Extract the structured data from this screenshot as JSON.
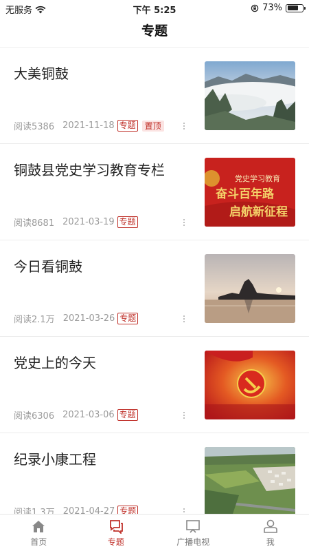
{
  "status_bar": {
    "carrier": "无服务",
    "time": "下午 5:25",
    "battery": "73%"
  },
  "nav": {
    "title": "专题"
  },
  "articles": [
    {
      "title": "大美铜鼓",
      "reads": "阅读5386",
      "date": "2021-11-18",
      "tag": "专题",
      "pin": "置顶"
    },
    {
      "title": "铜鼓县党史学习教育专栏",
      "reads": "阅读8681",
      "date": "2021-03-19",
      "tag": "专题",
      "thumb_text_small": "党史学习教育",
      "thumb_text_line1": "奋斗百年路",
      "thumb_text_line2": "启航新征程"
    },
    {
      "title": "今日看铜鼓",
      "reads": "阅读2.1万",
      "date": "2021-03-26",
      "tag": "专题"
    },
    {
      "title": "党史上的今天",
      "reads": "阅读6306",
      "date": "2021-03-06",
      "tag": "专题"
    },
    {
      "title": "纪录小康工程",
      "reads": "阅读1.3万",
      "date": "2021-04-27",
      "tag": "专题"
    }
  ],
  "tabbar": [
    {
      "label": "首页",
      "icon": "home-icon"
    },
    {
      "label": "专题",
      "icon": "chat-icon",
      "active": true
    },
    {
      "label": "广播电视",
      "icon": "tv-icon"
    },
    {
      "label": "我",
      "icon": "person-icon"
    }
  ],
  "colors": {
    "accent": "#c0322b"
  }
}
